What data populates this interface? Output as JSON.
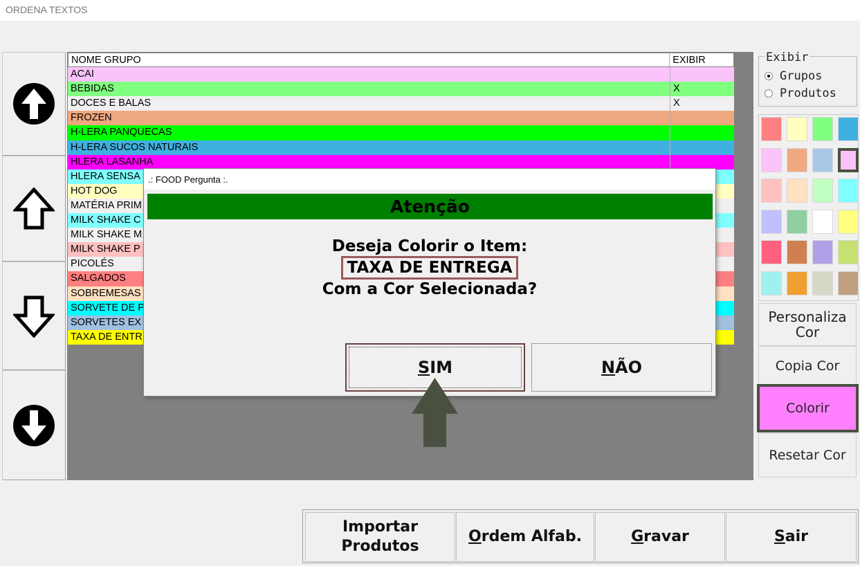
{
  "window": {
    "title": "ORDENA TEXTOS"
  },
  "nav": {
    "move_top_icon": "arrow-up-circle-icon",
    "move_up_icon": "arrow-up-outline-icon",
    "move_down_icon": "arrow-down-outline-icon",
    "move_bottom_icon": "arrow-down-circle-icon"
  },
  "grid": {
    "headers": {
      "name": "NOME GRUPO",
      "exibir": "EXIBIR"
    },
    "rows": [
      {
        "name": "ACAI",
        "exibir": "",
        "color": "#fac4fb"
      },
      {
        "name": "BEBIDAS",
        "exibir": "X",
        "color": "#80ff80"
      },
      {
        "name": "DOCES E BALAS",
        "exibir": "X",
        "color": "#f0f0f0"
      },
      {
        "name": "FROZEN",
        "exibir": "",
        "color": "#f0a880"
      },
      {
        "name": "H-LERA PANQUECAS",
        "exibir": "",
        "color": "#00ff00"
      },
      {
        "name": "H-LERA SUCOS NATURAIS",
        "exibir": "",
        "color": "#40b0e0"
      },
      {
        "name": "HLERA LASANHA",
        "exibir": "",
        "color": "#ff00ff"
      },
      {
        "name": "HLERA SENSA",
        "exibir": "",
        "color": "#80ffff"
      },
      {
        "name": "HOT DOG",
        "exibir": "",
        "color": "#ffffc0"
      },
      {
        "name": "MATÉRIA PRIM",
        "exibir": "",
        "color": "#f0f0f0"
      },
      {
        "name": "MILK SHAKE C",
        "exibir": "",
        "color": "#80ffff"
      },
      {
        "name": "MILK SHAKE M",
        "exibir": "",
        "color": "#f0f0f0"
      },
      {
        "name": "MILK SHAKE P",
        "exibir": "",
        "color": "#ffc0c0"
      },
      {
        "name": "PICOLÉS",
        "exibir": "",
        "color": "#f0f0f0"
      },
      {
        "name": "SALGADOS",
        "exibir": "",
        "color": "#ff8080"
      },
      {
        "name": "SOBREMESAS",
        "exibir": "",
        "color": "#ffe0c0"
      },
      {
        "name": "SORVETE DE P",
        "exibir": "",
        "color": "#00ffff"
      },
      {
        "name": "SORVETES EX",
        "exibir": "",
        "color": "#a0c0e0"
      },
      {
        "name": "TAXA DE ENTR",
        "exibir": "",
        "color": "#ffff00"
      }
    ]
  },
  "exibir": {
    "legend": "Exibir",
    "options": [
      {
        "label": "Grupos",
        "checked": true
      },
      {
        "label": "Produtos",
        "checked": false
      }
    ]
  },
  "palette": {
    "selected_index": 7,
    "colors": [
      "#ff8080",
      "#ffffc0",
      "#80ff80",
      "#40b0e0",
      "#fac4fb",
      "#f0a880",
      "#a8c8e8",
      "#fac4fb",
      "#ffc0c0",
      "#ffe0c0",
      "#c0ffc0",
      "#80ffff",
      "#c0c0ff",
      "#90d0a0",
      "#ffffff",
      "#ffff80",
      "#ff6080",
      "#d08050",
      "#b0a0e8",
      "#c8e070",
      "#a0f0f0",
      "#f0a030",
      "#d8d8c8",
      "#c0a080"
    ]
  },
  "side_buttons": {
    "personaliza": "Personaliza Cor",
    "copia": "Copia Cor",
    "colorir": "Colorir",
    "colorir_color": "#ff80ff",
    "resetar": "Resetar Cor"
  },
  "bottom_buttons": {
    "importar": "Importar Produtos",
    "ordem_first": "O",
    "ordem_rest": "rdem Alfab.",
    "gravar_first": "G",
    "gravar_rest": "ravar",
    "sair_first": "S",
    "sair_rest": "air"
  },
  "dialog": {
    "title": ".: FOOD Pergunta :.",
    "banner": "Atenção",
    "banner_color": "#008000",
    "line1": "Deseja Colorir o Item:",
    "item": "TAXA DE ENTREGA",
    "line3": "Com a Cor Selecionada?",
    "sim_first": "S",
    "sim_rest": "IM",
    "nao_first": "N",
    "nao_rest": "ÃO"
  }
}
